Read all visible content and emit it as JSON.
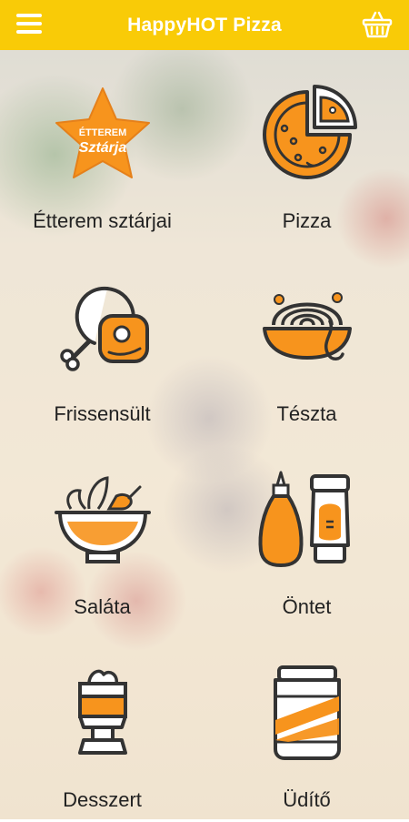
{
  "colors": {
    "header": "#f9cb07",
    "accent": "#f7941d",
    "icon_stroke": "#333333"
  },
  "header": {
    "title": "HappyHOT Pizza",
    "menu_icon": "hamburger-menu-icon",
    "cart_icon": "basket-icon"
  },
  "menu": {
    "items": [
      {
        "label": "Étterem sztárjai",
        "icon": "star-badge-icon",
        "badge_line1": "ÉTTEREM",
        "badge_line2": "Sztárja"
      },
      {
        "label": "Pizza",
        "icon": "pizza-icon"
      },
      {
        "label": "Frissensült",
        "icon": "roast-meat-icon"
      },
      {
        "label": "Tészta",
        "icon": "pasta-icon"
      },
      {
        "label": "Saláta",
        "icon": "salad-bowl-icon"
      },
      {
        "label": "Öntet",
        "icon": "sauce-bottles-icon"
      },
      {
        "label": "Desszert",
        "icon": "dessert-cup-icon"
      },
      {
        "label": "Üdítő",
        "icon": "soda-can-icon"
      }
    ]
  }
}
